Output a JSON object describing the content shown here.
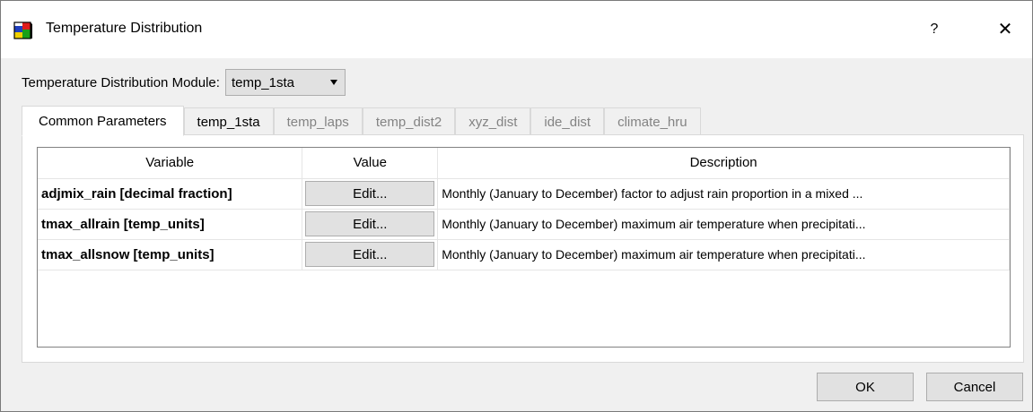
{
  "window": {
    "title": "Temperature Distribution",
    "help": "?",
    "close": "✕"
  },
  "module": {
    "label": "Temperature Distribution Module:",
    "selected": "temp_1sta"
  },
  "tabs": [
    {
      "label": "Common Parameters",
      "state": "active"
    },
    {
      "label": "temp_1sta",
      "state": "enabled"
    },
    {
      "label": "temp_laps",
      "state": "disabled"
    },
    {
      "label": "temp_dist2",
      "state": "disabled"
    },
    {
      "label": "xyz_dist",
      "state": "disabled"
    },
    {
      "label": "ide_dist",
      "state": "disabled"
    },
    {
      "label": "climate_hru",
      "state": "disabled"
    }
  ],
  "table": {
    "headers": [
      "Variable",
      "Value",
      "Description"
    ],
    "rows": [
      {
        "variable": "adjmix_rain [decimal fraction]",
        "value": "Edit...",
        "description": "Monthly (January to December) factor to adjust rain proportion in a mixed ..."
      },
      {
        "variable": "tmax_allrain [temp_units]",
        "value": "Edit...",
        "description": "Monthly (January to December) maximum air temperature when precipitati..."
      },
      {
        "variable": "tmax_allsnow [temp_units]",
        "value": "Edit...",
        "description": "Monthly (January to December) maximum air temperature when precipitati..."
      }
    ]
  },
  "buttons": {
    "ok": "OK",
    "cancel": "Cancel"
  }
}
